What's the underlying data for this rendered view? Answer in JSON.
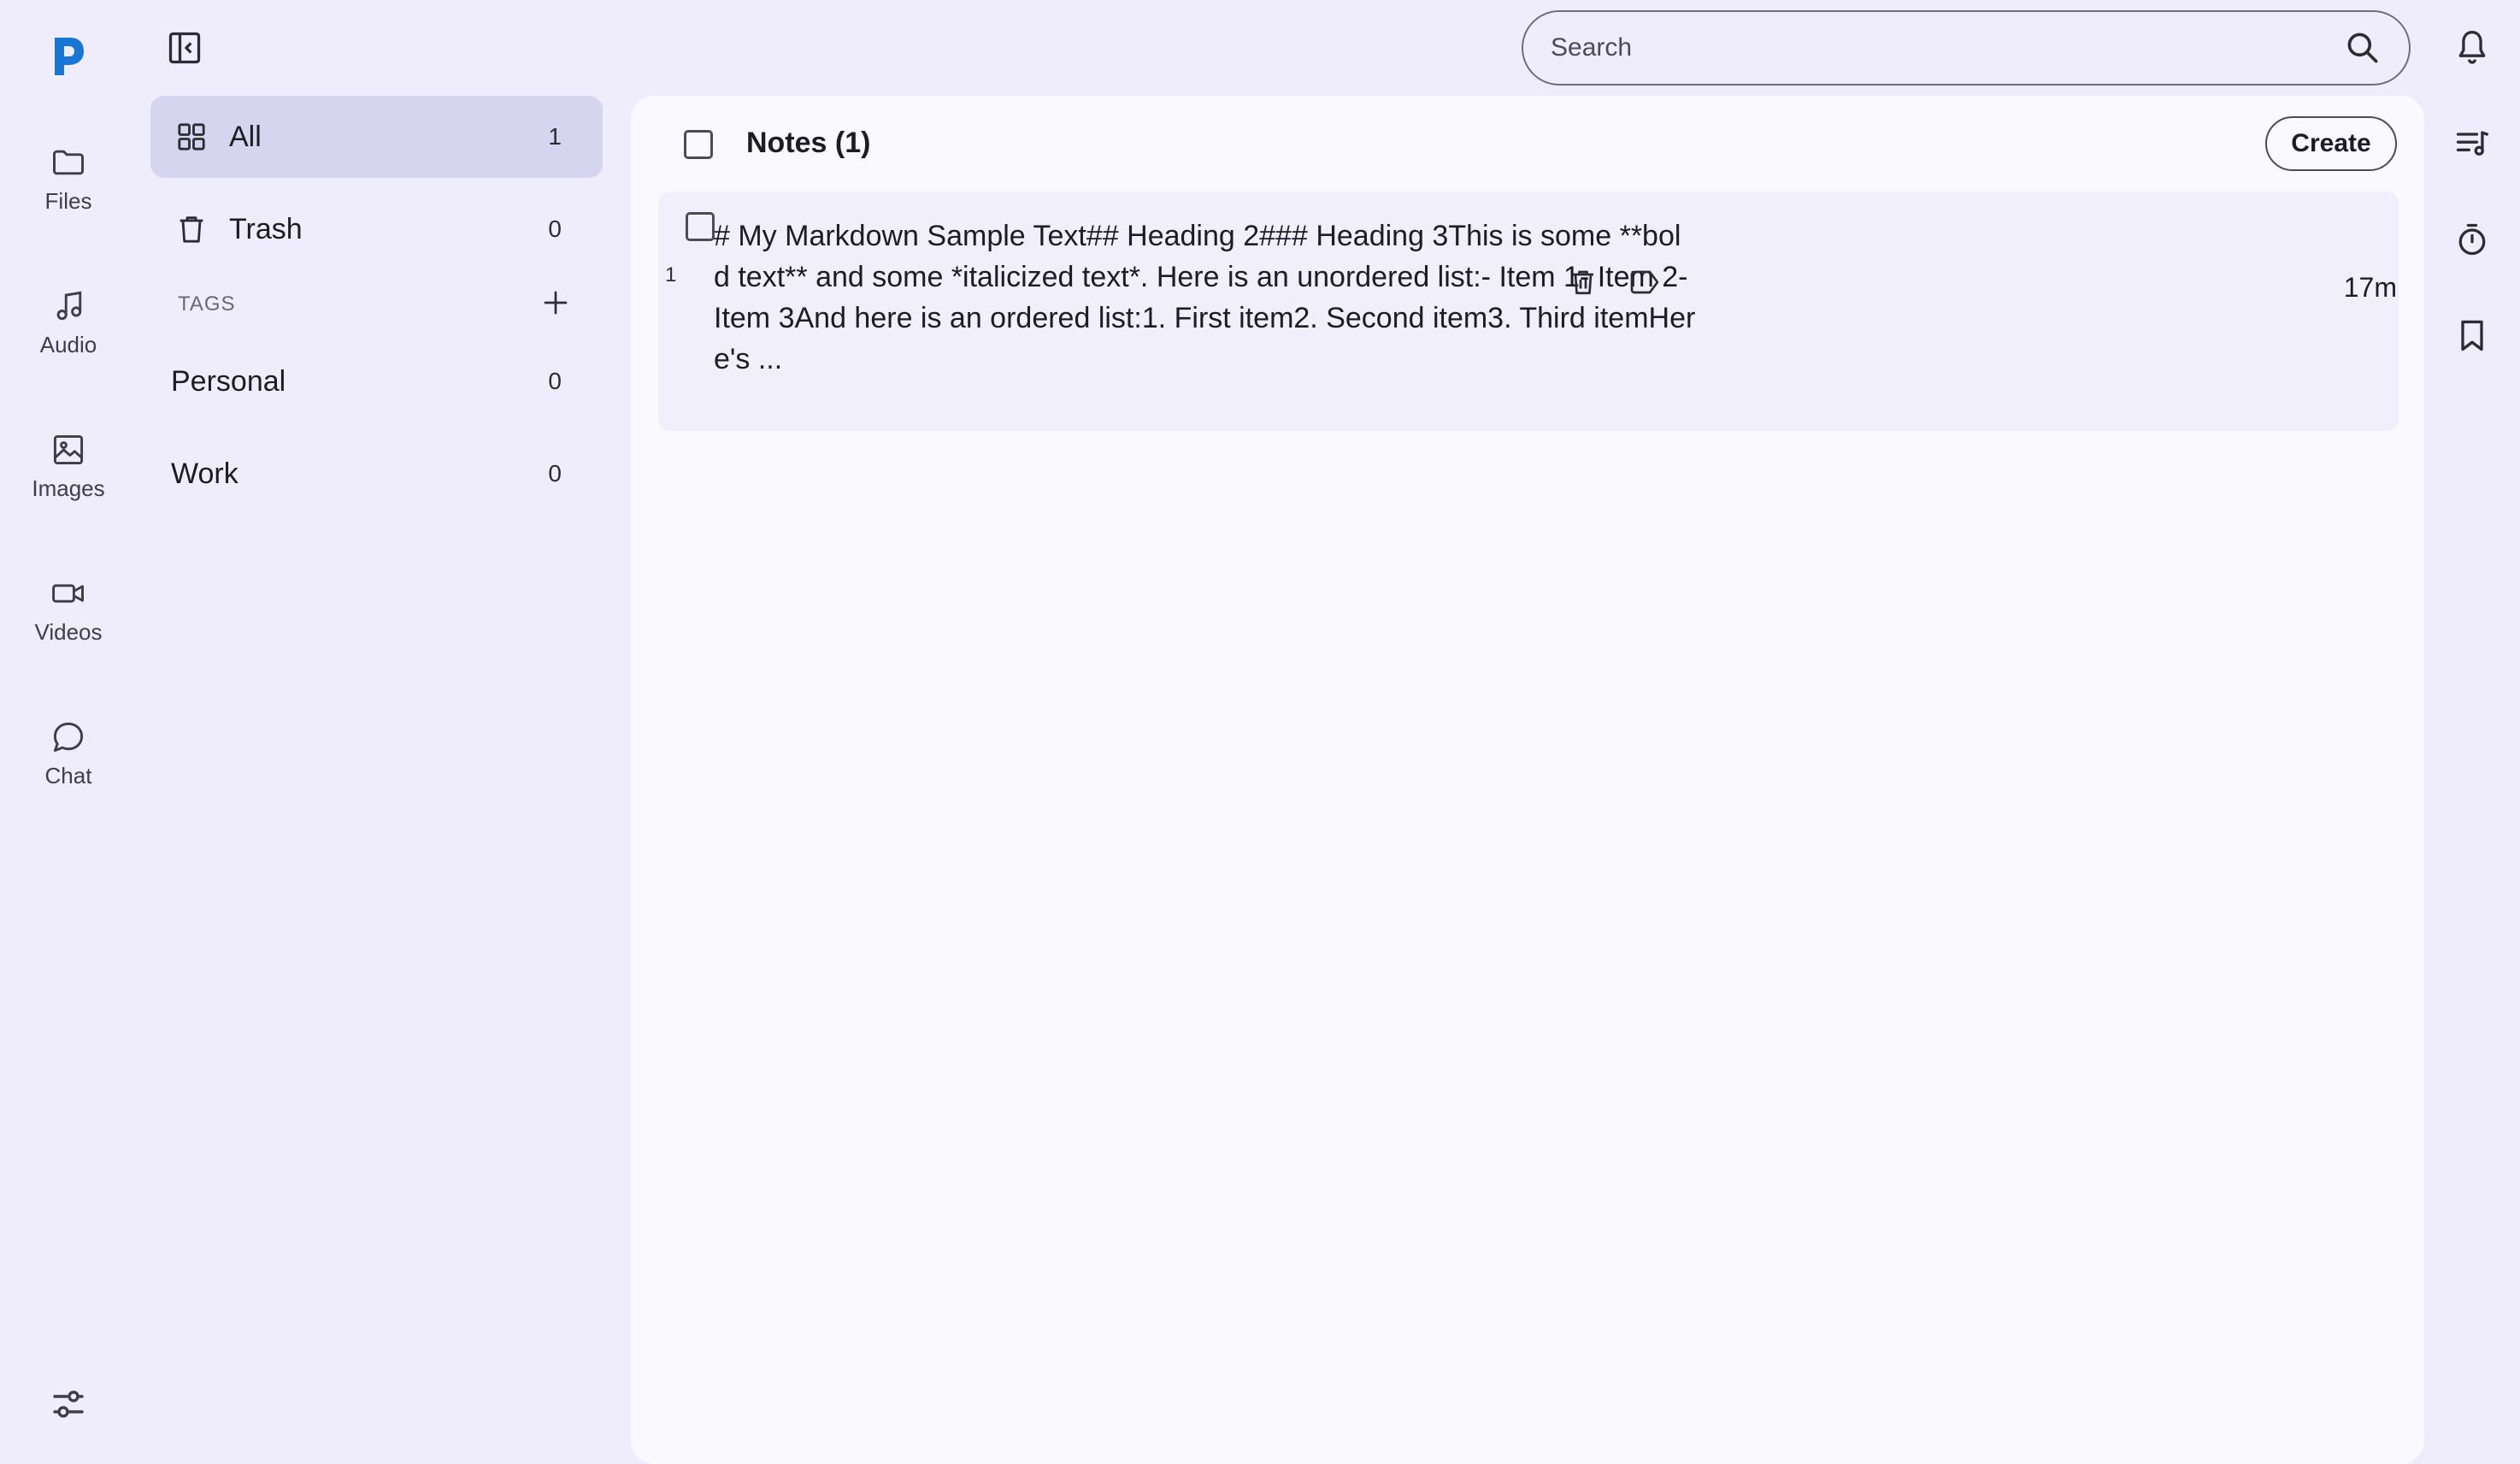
{
  "rail": {
    "items": [
      {
        "label": "Files",
        "icon": "folder-icon"
      },
      {
        "label": "Audio",
        "icon": "music-note-icon"
      },
      {
        "label": "Images",
        "icon": "image-icon"
      },
      {
        "label": "Videos",
        "icon": "video-camera-icon"
      },
      {
        "label": "Chat",
        "icon": "chat-bubble-icon"
      }
    ]
  },
  "sidebar": {
    "nav": [
      {
        "label": "All",
        "count": "1",
        "icon": "grid-icon",
        "active": true
      },
      {
        "label": "Trash",
        "count": "0",
        "icon": "trash-icon",
        "active": false
      }
    ],
    "tags_heading": "TAGS",
    "tags": [
      {
        "label": "Personal",
        "count": "0"
      },
      {
        "label": "Work",
        "count": "0"
      }
    ]
  },
  "search": {
    "placeholder": "Search",
    "value": ""
  },
  "main": {
    "title": "Notes (1)",
    "create_label": "Create",
    "notes": [
      {
        "index": "1",
        "text": "# My Markdown Sample Text## Heading 2### Heading 3This is some **bold text** and some *italicized text*. Here is an unordered list:- Item 1- Item 2- Item 3And here is an ordered list:1. First item2. Second item3. Third itemHere's ...",
        "time": "17m"
      }
    ]
  },
  "colors": {
    "background": "#efedfb",
    "panel": "#faf9fe",
    "active_nav": "#d6d5ef",
    "brand": "#1976d2"
  }
}
